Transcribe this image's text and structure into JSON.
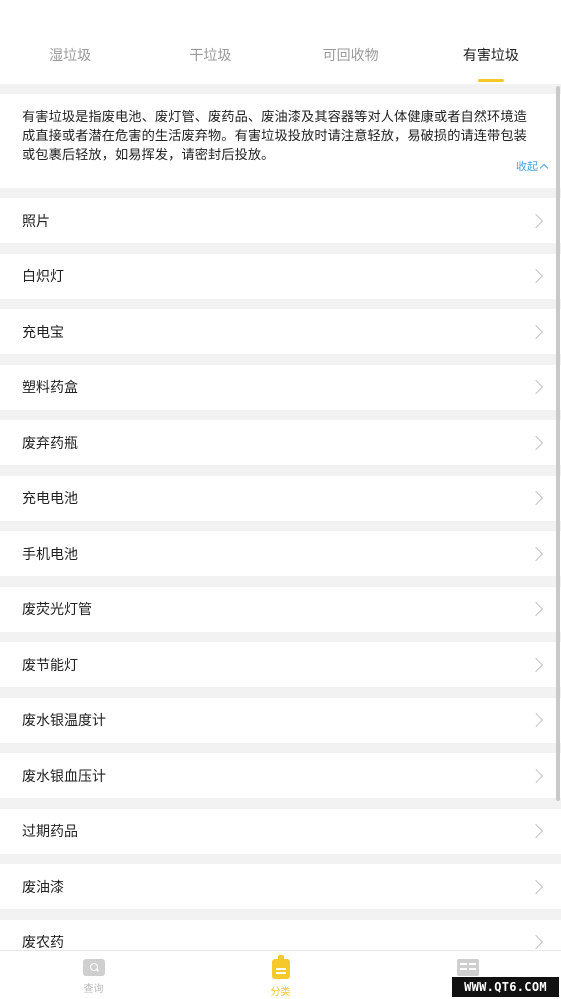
{
  "tabs": [
    {
      "label": "湿垃圾",
      "active": false
    },
    {
      "label": "干垃圾",
      "active": false
    },
    {
      "label": "可回收物",
      "active": false
    },
    {
      "label": "有害垃圾",
      "active": true
    }
  ],
  "description": {
    "text": "有害垃圾是指废电池、废灯管、废药品、废油漆及其容器等对人体健康或者自然环境造成直接或者潜在危害的生活废弃物。有害垃圾投放时请注意轻放，易破损的请连带包装或包裹后轻放，如易挥发，请密封后投放。",
    "collapse_label": "收起"
  },
  "items": [
    {
      "label": "照片"
    },
    {
      "label": "白炽灯"
    },
    {
      "label": "充电宝"
    },
    {
      "label": "塑料药盒"
    },
    {
      "label": "废弃药瓶"
    },
    {
      "label": "充电电池"
    },
    {
      "label": "手机电池"
    },
    {
      "label": "废荧光灯管"
    },
    {
      "label": "废节能灯"
    },
    {
      "label": "废水银温度计"
    },
    {
      "label": "废水银血压计"
    },
    {
      "label": "过期药品"
    },
    {
      "label": "废油漆"
    },
    {
      "label": "废农药"
    }
  ],
  "bottom_nav": [
    {
      "label": "查询",
      "icon": "search-icon",
      "active": false
    },
    {
      "label": "分类",
      "icon": "category-icon",
      "active": true
    },
    {
      "label": "",
      "icon": "news-icon",
      "active": false
    }
  ],
  "watermark": "WWW.QT6.COM",
  "colors": {
    "accent": "#f6c829",
    "link": "#4aa3df",
    "background": "#f2f2f2"
  }
}
